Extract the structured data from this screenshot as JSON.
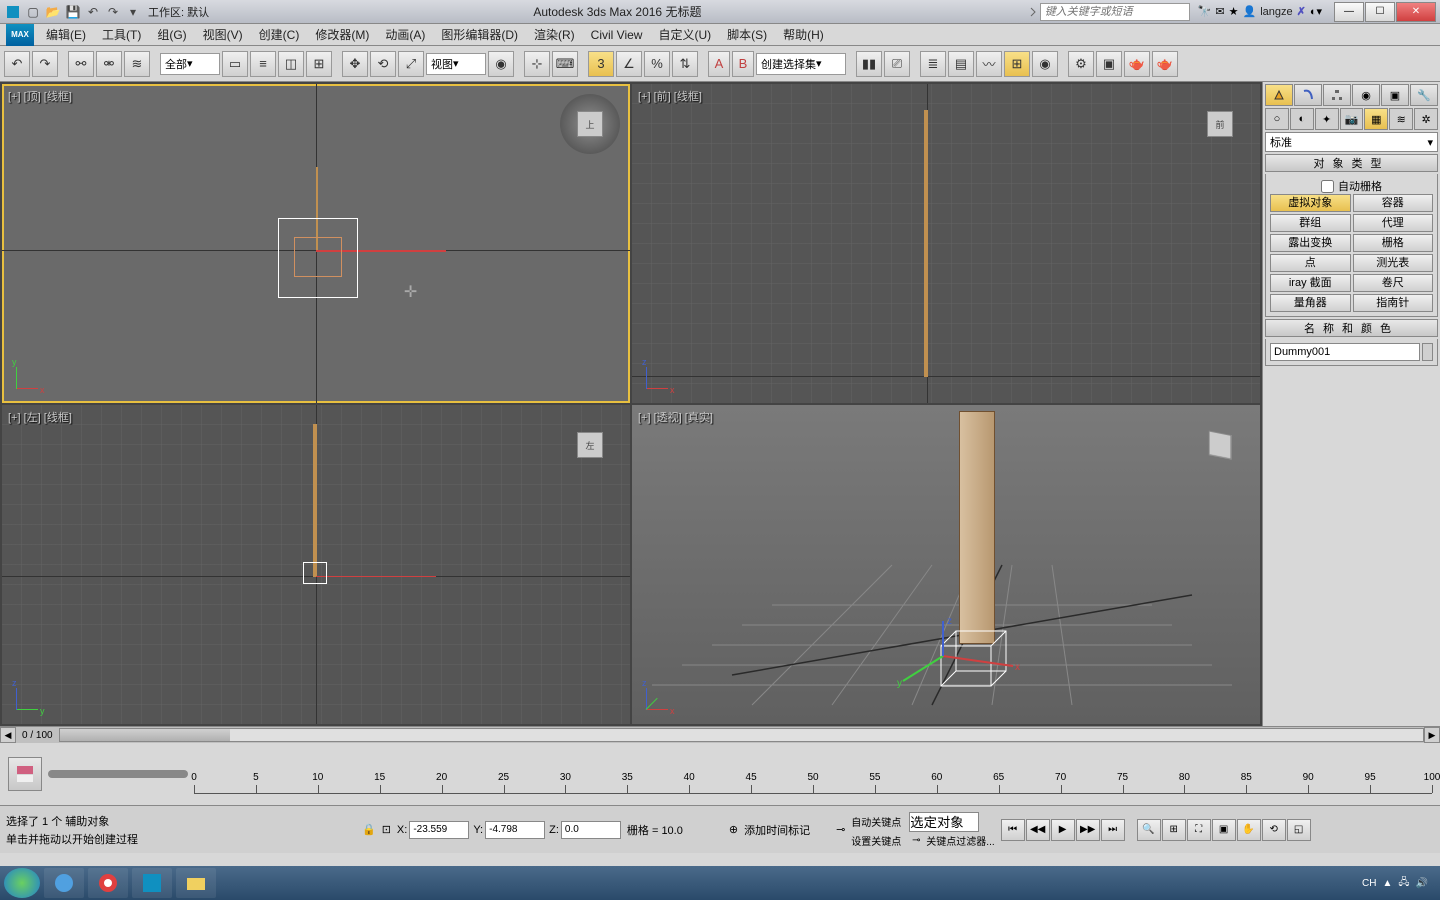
{
  "titlebar": {
    "workspace": "工作区: 默认",
    "app_title": "Autodesk 3ds Max 2016    无标题",
    "search_placeholder": "键入关键字或短语",
    "username": "langze"
  },
  "menu": [
    "编辑(E)",
    "工具(T)",
    "组(G)",
    "视图(V)",
    "创建(C)",
    "修改器(M)",
    "动画(A)",
    "图形编辑器(D)",
    "渲染(R)",
    "Civil View",
    "自定义(U)",
    "脚本(S)",
    "帮助(H)"
  ],
  "toolbar": {
    "filter_dd": "全部",
    "view_dd": "视图",
    "selset_dd": "创建选择集"
  },
  "viewports": {
    "top": "[+] [顶] [线框]",
    "front": "[+] [前] [线框]",
    "left": "[+] [左] [线框]",
    "persp": "[+] [透视] [真实]",
    "cube_top": "上",
    "cube_left": "左"
  },
  "panel": {
    "dd": "标准",
    "rollout_objtype": "对象类型",
    "autogrid": "自动栅格",
    "btns": [
      "虚拟对象",
      "容器",
      "群组",
      "代理",
      "露出变换",
      "栅格",
      "点",
      "测光表",
      "iray 截面",
      "卷尺",
      "量角器",
      "指南针"
    ],
    "rollout_name": "名称和颜色",
    "obj_name": "Dummy001"
  },
  "timeline": {
    "frames_label": "0 / 100",
    "ticks": [
      0,
      5,
      10,
      15,
      20,
      25,
      30,
      35,
      40,
      45,
      50,
      55,
      60,
      65,
      70,
      75,
      80,
      85,
      90,
      95,
      100
    ],
    "prompt1": "选择了 1 个 辅助对象",
    "prompt2": "单击并拖动以开始创建过程",
    "add_marker": "添加时间标记"
  },
  "coords": {
    "x_lbl": "X:",
    "x": "-23.559",
    "y_lbl": "Y:",
    "y": "-4.798",
    "z_lbl": "Z:",
    "z": "0.0",
    "grid": "栅格 = 10.0"
  },
  "keys": {
    "autokey": "自动关键点",
    "setkey": "设置关键点",
    "seldd": "选定对象",
    "filter": "关键点过滤器..."
  },
  "taskbar": {
    "ime": "CH",
    "tray1": "▲"
  }
}
